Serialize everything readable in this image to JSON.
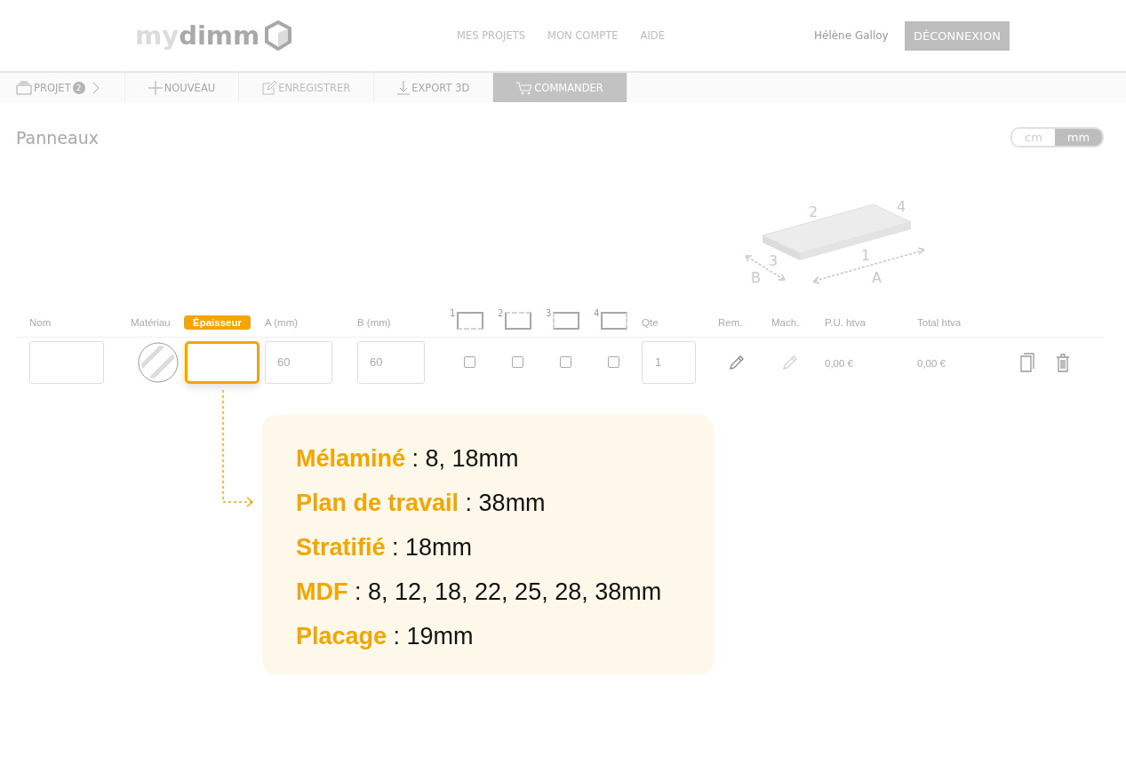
{
  "header": {
    "logo": {
      "light": "my",
      "dark": "dimm"
    },
    "nav": [
      "MES PROJETS",
      "MON COMPTE",
      "AIDE"
    ],
    "user": "Hélène Galloy",
    "logout": "DÉCONNEXION"
  },
  "toolbar": [
    {
      "kind": "project",
      "label": "PROJET",
      "badge": "2",
      "disabled": false,
      "selected": false
    },
    {
      "kind": "new",
      "label": "NOUVEAU",
      "disabled": false,
      "selected": false
    },
    {
      "kind": "save",
      "label": "ENREGISTRER",
      "disabled": true,
      "selected": false
    },
    {
      "kind": "export",
      "label": "EXPORT 3D",
      "disabled": false,
      "selected": false
    },
    {
      "kind": "order",
      "label": "COMMANDER",
      "disabled": false,
      "selected": true
    }
  ],
  "title": "Panneaux",
  "units": [
    {
      "label": "cm",
      "selected": false
    },
    {
      "label": "mm",
      "selected": true
    }
  ],
  "diagram": {
    "labels": [
      "2",
      "4",
      "3",
      "1",
      "B",
      "A"
    ]
  },
  "table": {
    "columns": [
      {
        "kind": "text",
        "label": "Nom",
        "highlighted": false
      },
      {
        "kind": "text",
        "label": "Matériau",
        "highlighted": false
      },
      {
        "kind": "text",
        "label": "Épaisseur",
        "highlighted": true
      },
      {
        "kind": "text",
        "label": "A (mm)",
        "highlighted": false
      },
      {
        "kind": "text",
        "label": "B (mm)",
        "highlighted": false
      },
      {
        "kind": "edge",
        "label": "1"
      },
      {
        "kind": "edge",
        "label": "2"
      },
      {
        "kind": "edge",
        "label": "3"
      },
      {
        "kind": "edge",
        "label": "4"
      },
      {
        "kind": "text",
        "label": "Qte",
        "highlighted": false
      },
      {
        "kind": "text",
        "label": "Rem.",
        "highlighted": false
      },
      {
        "kind": "text",
        "label": "Mach.",
        "highlighted": false
      },
      {
        "kind": "text",
        "label": "P.U. htva",
        "highlighted": false
      },
      {
        "kind": "text",
        "label": "Total htva",
        "highlighted": false
      }
    ],
    "row": {
      "thickness_focused": true,
      "a": "60",
      "b": "60",
      "edges": [
        {
          "checked": false
        },
        {
          "checked": false
        },
        {
          "checked": false
        },
        {
          "checked": false
        }
      ],
      "qty": "1",
      "rem_disabled": false,
      "mach_disabled": true,
      "unit_price": "0,00 €",
      "total": "0,00 €"
    }
  },
  "tooltip": [
    "**Mélaminé** : 8, 18mm",
    "**Plan de travail** : 38mm",
    "**Stratifié** : 18mm",
    "**MDF** : 8, 12, 18, 22, 25, 28, 38mm",
    "**Placage** : 19mm"
  ]
}
